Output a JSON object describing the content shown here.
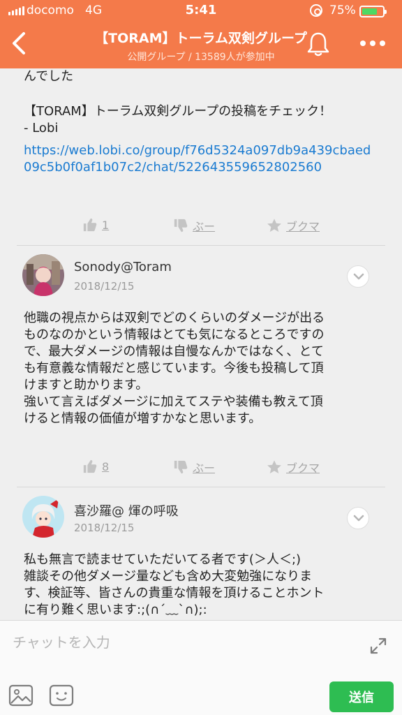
{
  "status_bar": {
    "carrier": "docomo",
    "network": "4G",
    "time": "5:41",
    "battery_percent": "75%",
    "battery_level": 0.75
  },
  "header": {
    "title": "【TORAM】トーラム双剣グループ",
    "subtitle": "公開グループ / 13589人が参加中",
    "icons": {
      "back": "back-chevron-icon",
      "bell": "bell-icon",
      "more": "more-icon"
    },
    "color": "#f47a4a"
  },
  "posts": [
    {
      "text_top": "んでした",
      "share_text": "【TORAM】トーラム双剣グループの投稿をチェック！\n- Lobi",
      "link": "https://web.lobi.co/group/f76d5324a097db9a439cbaed09c5b0f0af1b07c2/chat/522643559652802560",
      "like_count": "1",
      "boo_label": "ぶー",
      "bookmark_label": "ブクマ"
    },
    {
      "user": "Sonody@Toram",
      "date": "2018/12/15",
      "body": "他職の視点からは双剣でどのくらいのダメージが出る\nものなのかという情報はとても気になるところですの\nで、最大ダメージの情報は自慢なんかではなく、とて\nも有意義な情報だと感じています。今後も投稿して頂\nけますと助かります。\n強いて言えばダメージに加えてステや装備も教えて頂\nけると情報の価値が増すかなと思います。",
      "like_count": "8",
      "boo_label": "ぶー",
      "bookmark_label": "ブクマ"
    },
    {
      "user": "喜沙羅@ 煇の呼吸",
      "date": "2018/12/15",
      "body": "私も無言で読ませていただいてる者です(＞人＜;)\n雑談その他ダメージ量なども含め大変勉強になりま\nす、検証等、皆さんの貴重な情報を頂けることホント\nに有り難く思います:;(∩´﹏`∩);:"
    }
  ],
  "composer": {
    "placeholder": "チャットを入力",
    "send_label": "送信",
    "icons": {
      "expand": "expand-icon",
      "image": "image-icon",
      "emoji": "emoji-icon"
    },
    "send_color": "#2ebd52"
  }
}
